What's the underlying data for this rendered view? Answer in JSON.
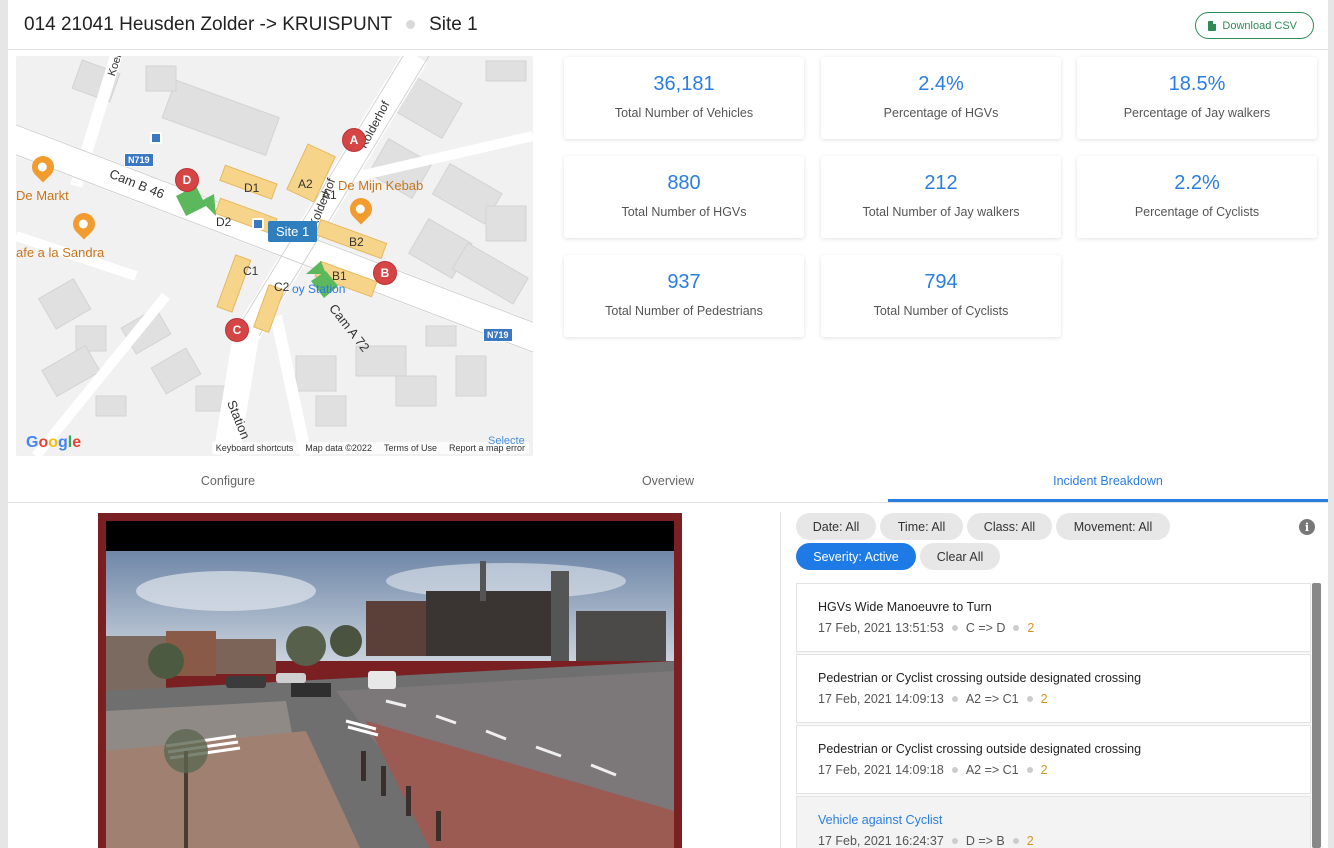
{
  "header": {
    "title": "014 21041 Heusden Zolder -> KRUISPUNT",
    "site": "Site 1",
    "download_label": "Download CSV",
    "download_icon": "file-icon"
  },
  "map": {
    "site_badge": "Site 1",
    "road_tags": [
      "N719",
      "N719"
    ],
    "street_labels": {
      "koeltorenlaan": "Koeltorenlaa",
      "kolderhof": "Kolderhof",
      "kolderhof2": "Kolderhof",
      "cam_b": "Cam B 46",
      "cam_a": "Cam A 72",
      "station": "Station"
    },
    "poi_labels": {
      "de_markt": "De Markt",
      "cafe": "afe a la Sandra",
      "kebab": "De Mijn Kebab",
      "station_poi": "oy Station"
    },
    "markers": [
      "A",
      "B",
      "C",
      "D"
    ],
    "zone_labels": [
      "D1",
      "D2",
      "A2",
      "A1",
      "B2",
      "B1",
      "C1",
      "C2"
    ],
    "google_logo": [
      "G",
      "o",
      "o",
      "g",
      "l",
      "e"
    ],
    "footer": [
      "Keyboard shortcuts",
      "Map data ©2022",
      "Terms of Use",
      "Report a map error"
    ],
    "footer_extra": "Selecte"
  },
  "stats": [
    {
      "value": "36,181",
      "label": "Total Number of Vehicles"
    },
    {
      "value": "2.4%",
      "label": "Percentage of HGVs"
    },
    {
      "value": "18.5%",
      "label": "Percentage of Jay walkers"
    },
    {
      "value": "880",
      "label": "Total Number of HGVs"
    },
    {
      "value": "212",
      "label": "Total Number of Jay walkers"
    },
    {
      "value": "2.2%",
      "label": "Percentage of Cyclists"
    },
    {
      "value": "937",
      "label": "Total Number of Pedestrians"
    },
    {
      "value": "794",
      "label": "Total Number of Cyclists"
    }
  ],
  "tabs": [
    "Configure",
    "Overview",
    "Incident Breakdown"
  ],
  "active_tab": "Incident Breakdown",
  "filters": {
    "date": "Date: All",
    "time": "Time: All",
    "class": "Class: All",
    "movement": "Movement: All",
    "severity": "Severity: Active",
    "clear": "Clear All"
  },
  "info_icon": "i",
  "incidents": [
    {
      "title": "HGVs Wide Manoeuvre to Turn",
      "time": "17 Feb, 2021 13:51:53",
      "movement": "C => D",
      "count": "2"
    },
    {
      "title": "Pedestrian or Cyclist crossing outside designated crossing",
      "time": "17 Feb, 2021 14:09:13",
      "movement": "A2 => C1",
      "count": "2"
    },
    {
      "title": "Pedestrian or Cyclist crossing outside designated crossing",
      "time": "17 Feb, 2021 14:09:18",
      "movement": "A2 => C1",
      "count": "2"
    },
    {
      "title": "Vehicle against Cyclist",
      "time": "17 Feb, 2021 16:24:37",
      "movement": "D => B",
      "count": "2"
    }
  ],
  "colors": {
    "accent": "#2a7de1",
    "download_green": "#2e8b57",
    "marker_red": "#d64545",
    "count_orange": "#d4942a",
    "zone_fill": "#f6d48a",
    "camera_green": "#5cb85c"
  }
}
